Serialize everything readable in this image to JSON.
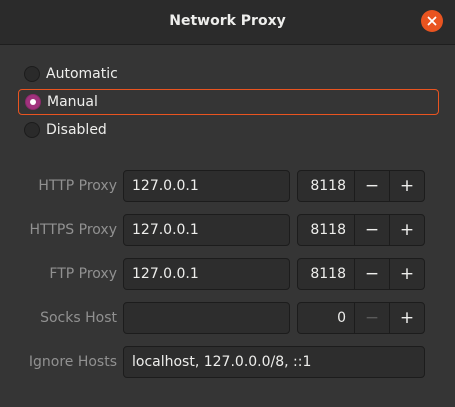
{
  "window": {
    "title": "Network Proxy"
  },
  "modes": [
    {
      "label": "Automatic",
      "selected": false
    },
    {
      "label": "Manual",
      "selected": true
    },
    {
      "label": "Disabled",
      "selected": false
    }
  ],
  "proxies": [
    {
      "label": "HTTP Proxy",
      "host": "127.0.0.1",
      "port": "8118"
    },
    {
      "label": "HTTPS Proxy",
      "host": "127.0.0.1",
      "port": "8118"
    },
    {
      "label": "FTP Proxy",
      "host": "127.0.0.1",
      "port": "8118"
    },
    {
      "label": "Socks Host",
      "host": "",
      "port": "0"
    }
  ],
  "ignore_hosts": {
    "label": "Ignore Hosts",
    "value": "localhost, 127.0.0.0/8, ::1"
  },
  "spin_symbols": {
    "minus": "−",
    "plus": "+"
  },
  "colors": {
    "accent": "#e95420",
    "radio_checked": "#a1327d"
  }
}
